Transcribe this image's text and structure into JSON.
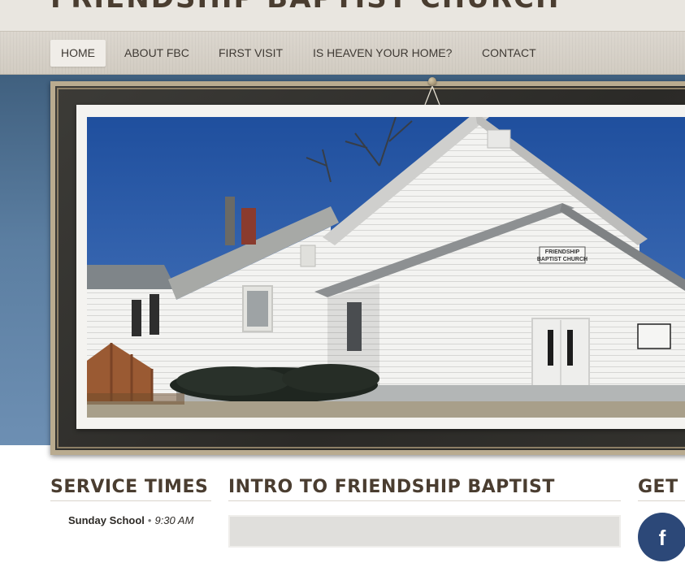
{
  "site": {
    "title": "FRIENDSHIP BAPTIST CHURCH"
  },
  "nav": {
    "items": [
      {
        "label": "HOME",
        "active": true
      },
      {
        "label": "ABOUT FBC",
        "active": false
      },
      {
        "label": "FIRST VISIT",
        "active": false
      },
      {
        "label": "IS HEAVEN YOUR HOME?",
        "active": false
      },
      {
        "label": "CONTACT",
        "active": false
      }
    ]
  },
  "hero": {
    "sign_line1": "FRIENDSHIP",
    "sign_line2": "BAPTIST CHURCH"
  },
  "service_times": {
    "title": "SERVICE TIMES",
    "items": [
      {
        "name": "Sunday School",
        "time": "9:30 AM"
      }
    ]
  },
  "intro": {
    "title": "INTRO TO FRIENDSHIP BAPTIST"
  },
  "connect": {
    "title": "GET C",
    "facebook_glyph": "f"
  },
  "colors": {
    "heading": "#4a3d30",
    "hero_blue": "#5b7ea1",
    "facebook": "#2c4878"
  },
  "icons": {
    "facebook": "facebook-icon"
  }
}
